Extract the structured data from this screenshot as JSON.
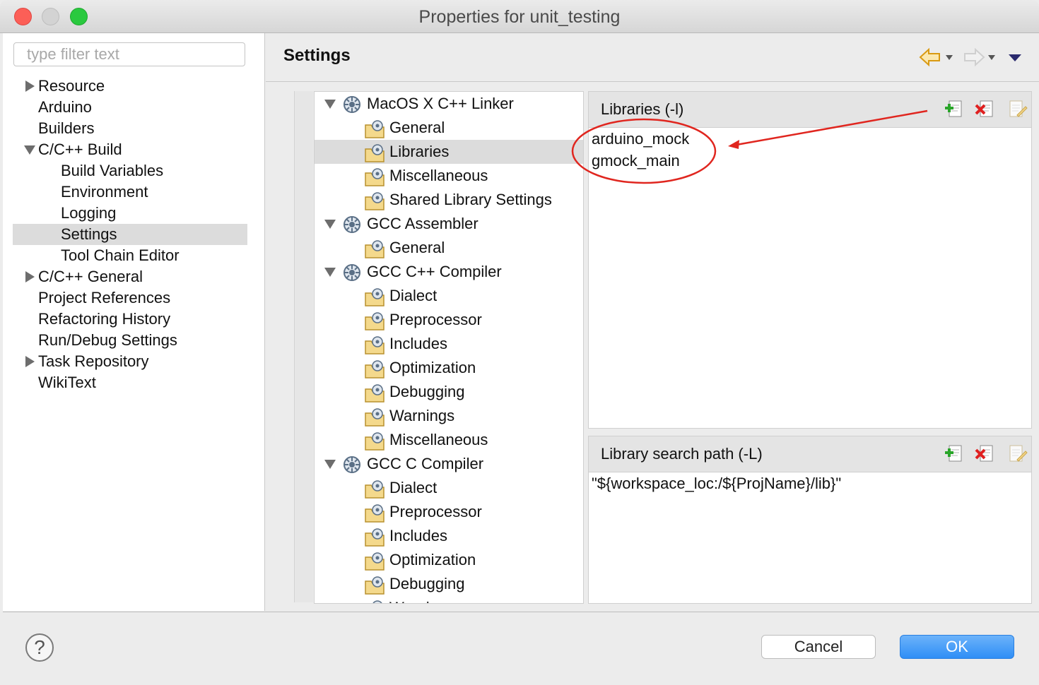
{
  "window": {
    "title": "Properties for unit_testing"
  },
  "filter": {
    "placeholder": "type filter text",
    "value": ""
  },
  "nav": {
    "items": [
      {
        "label": "Resource",
        "expander": "collapsed",
        "level": 0
      },
      {
        "label": "Arduino",
        "expander": "none",
        "level": 0
      },
      {
        "label": "Builders",
        "expander": "none",
        "level": 0
      },
      {
        "label": "C/C++ Build",
        "expander": "expanded",
        "level": 0
      },
      {
        "label": "Build Variables",
        "expander": "none",
        "level": 1
      },
      {
        "label": "Environment",
        "expander": "none",
        "level": 1
      },
      {
        "label": "Logging",
        "expander": "none",
        "level": 1
      },
      {
        "label": "Settings",
        "expander": "none",
        "level": 1,
        "selected": true
      },
      {
        "label": "Tool Chain Editor",
        "expander": "none",
        "level": 1
      },
      {
        "label": "C/C++ General",
        "expander": "collapsed",
        "level": 0
      },
      {
        "label": "Project References",
        "expander": "none",
        "level": 0
      },
      {
        "label": "Refactoring History",
        "expander": "none",
        "level": 0
      },
      {
        "label": "Run/Debug Settings",
        "expander": "none",
        "level": 0
      },
      {
        "label": "Task Repository",
        "expander": "collapsed",
        "level": 0
      },
      {
        "label": "WikiText",
        "expander": "none",
        "level": 0
      }
    ]
  },
  "header": {
    "title": "Settings"
  },
  "tool_tree": {
    "items": [
      {
        "label": "MacOS X C++ Linker",
        "type": "tool"
      },
      {
        "label": "General",
        "type": "option"
      },
      {
        "label": "Libraries",
        "type": "option",
        "selected": true
      },
      {
        "label": "Miscellaneous",
        "type": "option"
      },
      {
        "label": "Shared Library Settings",
        "type": "option"
      },
      {
        "label": "GCC Assembler",
        "type": "tool"
      },
      {
        "label": "General",
        "type": "option"
      },
      {
        "label": "GCC C++ Compiler",
        "type": "tool"
      },
      {
        "label": "Dialect",
        "type": "option"
      },
      {
        "label": "Preprocessor",
        "type": "option"
      },
      {
        "label": "Includes",
        "type": "option"
      },
      {
        "label": "Optimization",
        "type": "option"
      },
      {
        "label": "Debugging",
        "type": "option"
      },
      {
        "label": "Warnings",
        "type": "option"
      },
      {
        "label": "Miscellaneous",
        "type": "option"
      },
      {
        "label": "GCC C Compiler",
        "type": "tool"
      },
      {
        "label": "Dialect",
        "type": "option"
      },
      {
        "label": "Preprocessor",
        "type": "option"
      },
      {
        "label": "Includes",
        "type": "option"
      },
      {
        "label": "Optimization",
        "type": "option"
      },
      {
        "label": "Debugging",
        "type": "option"
      },
      {
        "label": "Warnings",
        "type": "option"
      }
    ]
  },
  "libraries": {
    "title": "Libraries (-l)",
    "items": [
      "arduino_mock",
      "gmock_main"
    ]
  },
  "search_path": {
    "title": "Library search path (-L)",
    "items": [
      "\"${workspace_loc:/${ProjName}/lib}\""
    ]
  },
  "footer": {
    "cancel_label": "Cancel",
    "ok_label": "OK",
    "help_glyph": "?"
  },
  "icons": {
    "back": "back-arrow-icon",
    "forward": "forward-arrow-icon",
    "menu": "view-menu-icon",
    "tool": "tool-gear-icon",
    "option": "option-folder-icon",
    "add": "add-icon",
    "delete": "delete-icon",
    "edit": "edit-icon"
  },
  "colors": {
    "annotation": "#e0261f",
    "ok_button": "#2f8ef6",
    "back_arrow": "#e8a516"
  }
}
